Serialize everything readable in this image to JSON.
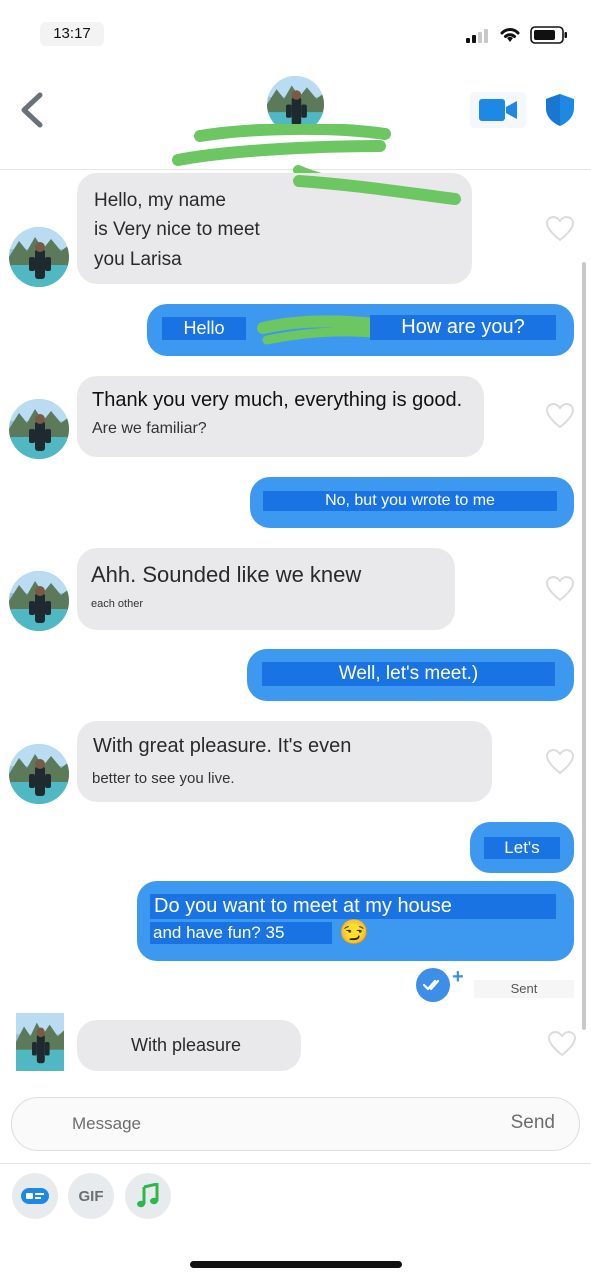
{
  "status_bar": {
    "time": "13:17"
  },
  "header": {
    "back_icon": "chevron-left-icon",
    "video_icon": "video-camera-icon",
    "shield_icon": "shield-icon"
  },
  "messages": [
    {
      "direction": "in",
      "lines": [
        "Hello, my name",
        "is Very nice to meet",
        "you Larisa"
      ]
    },
    {
      "direction": "out",
      "parts": [
        "Hello",
        "How are you?"
      ]
    },
    {
      "direction": "in",
      "lines": [
        "Thank you very much, everything is good.",
        "Are we familiar?"
      ]
    },
    {
      "direction": "out",
      "lines": [
        "No, but you wrote to me"
      ]
    },
    {
      "direction": "in",
      "lines": [
        "Ahh. Sounded like we knew",
        "each other"
      ]
    },
    {
      "direction": "out",
      "lines": [
        "Well, let's meet.)"
      ]
    },
    {
      "direction": "in",
      "lines": [
        "With great pleasure. It's even",
        "better to see you live."
      ]
    },
    {
      "direction": "out",
      "lines": [
        "Let's"
      ]
    },
    {
      "direction": "out",
      "lines": [
        "Do you want to meet at my house",
        "and have fun? 35"
      ],
      "emoji": "😏"
    },
    {
      "direction": "in",
      "lines": [
        "With pleasure"
      ]
    }
  ],
  "sent_status": "Sent",
  "composer": {
    "placeholder": "Message",
    "send_label": "Send"
  },
  "toolbar": {
    "gif_label": "GIF"
  },
  "colors": {
    "outgoing": "#3d98ef",
    "incoming": "#e9e9eb",
    "highlight": "#1a73e2",
    "accent": "#1e88e5"
  }
}
